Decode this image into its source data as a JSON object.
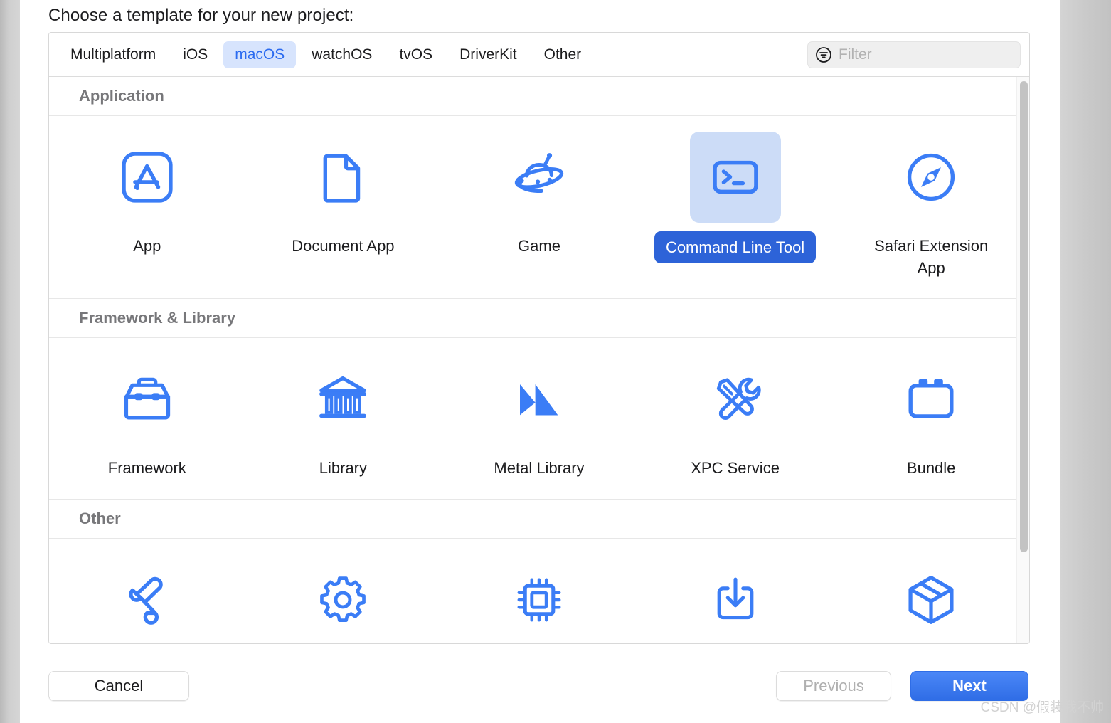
{
  "dialog": {
    "title": "Choose a template for your new project:"
  },
  "tabs": [
    {
      "label": "Multiplatform",
      "name": "tab-multiplatform",
      "selected": false
    },
    {
      "label": "iOS",
      "name": "tab-ios",
      "selected": false
    },
    {
      "label": "macOS",
      "name": "tab-macos",
      "selected": true
    },
    {
      "label": "watchOS",
      "name": "tab-watchos",
      "selected": false
    },
    {
      "label": "tvOS",
      "name": "tab-tvos",
      "selected": false
    },
    {
      "label": "DriverKit",
      "name": "tab-driverkit",
      "selected": false
    },
    {
      "label": "Other",
      "name": "tab-other",
      "selected": false
    }
  ],
  "filter": {
    "placeholder": "Filter",
    "value": "",
    "icon": "filter-icon"
  },
  "sections": [
    {
      "header": "Application",
      "templates": [
        {
          "label": "App",
          "icon": "app-store-icon",
          "selected": false
        },
        {
          "label": "Document App",
          "icon": "document-icon",
          "selected": false
        },
        {
          "label": "Game",
          "icon": "ufo-game-icon",
          "selected": false
        },
        {
          "label": "Command Line Tool",
          "icon": "terminal-icon",
          "selected": true
        },
        {
          "label": "Safari Extension App",
          "icon": "safari-compass-icon",
          "selected": false
        }
      ]
    },
    {
      "header": "Framework & Library",
      "templates": [
        {
          "label": "Framework",
          "icon": "toolbox-icon",
          "selected": false
        },
        {
          "label": "Library",
          "icon": "bank-columns-icon",
          "selected": false
        },
        {
          "label": "Metal Library",
          "icon": "metal-m-icon",
          "selected": false
        },
        {
          "label": "XPC Service",
          "icon": "screwdriver-wrench-icon",
          "selected": false
        },
        {
          "label": "Bundle",
          "icon": "bundle-box-icon",
          "selected": false
        }
      ]
    },
    {
      "header": "Other",
      "templates": [
        {
          "label": "",
          "icon": "scroll-icon",
          "selected": false
        },
        {
          "label": "",
          "icon": "gear-icon",
          "selected": false
        },
        {
          "label": "",
          "icon": "cpu-chip-icon",
          "selected": false
        },
        {
          "label": "",
          "icon": "download-tray-icon",
          "selected": false
        },
        {
          "label": "",
          "icon": "package-cube-icon",
          "selected": false
        }
      ]
    }
  ],
  "footer": {
    "cancel_label": "Cancel",
    "previous_label": "Previous",
    "next_label": "Next"
  },
  "watermark": "CSDN @假装我不帅",
  "colors": {
    "accent_blue": "#3b7df6",
    "selected_tab_bg": "#d7e4fd",
    "selected_tab_text": "#2b6bf0",
    "selected_tile_bg": "#ccdcf7",
    "selected_label_bg": "#2d63d8",
    "next_button": "#2f6de6",
    "section_header_text": "#77777a"
  }
}
